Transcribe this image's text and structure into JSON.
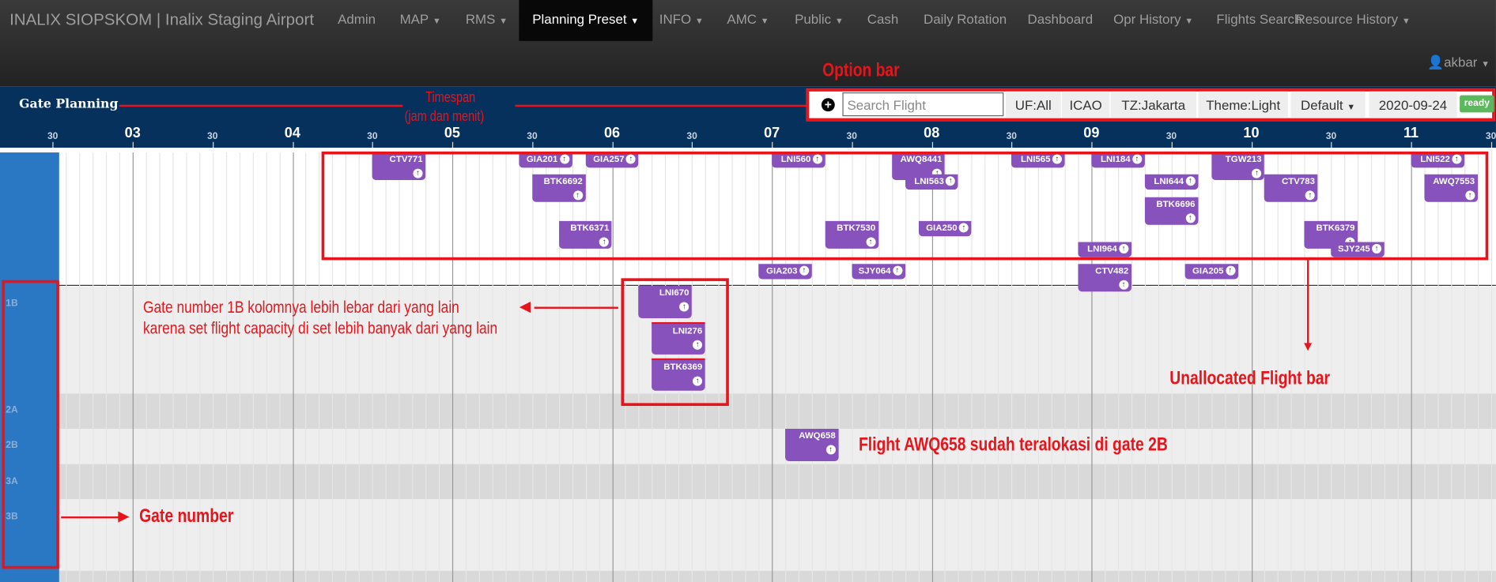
{
  "navbar": {
    "brand": "INALIX SIOPSKOM | Inalix Staging Airport",
    "items": [
      {
        "label": "Admin",
        "dropdown": false
      },
      {
        "label": "MAP",
        "dropdown": true
      },
      {
        "label": "RMS",
        "dropdown": true
      },
      {
        "label": "Planning Preset",
        "dropdown": true,
        "active": true
      },
      {
        "label": "INFO",
        "dropdown": true
      },
      {
        "label": "AMC",
        "dropdown": true
      },
      {
        "label": "Public",
        "dropdown": true
      },
      {
        "label": "Cash",
        "dropdown": false
      },
      {
        "label": "Daily Rotation",
        "dropdown": false
      },
      {
        "label": "Dashboard",
        "dropdown": false
      },
      {
        "label": "Opr History",
        "dropdown": true
      },
      {
        "label": "Flights Search",
        "dropdown": false
      },
      {
        "label": "Resource History",
        "dropdown": true
      }
    ],
    "user": "akbar"
  },
  "header": {
    "title": "Gate Planning"
  },
  "options": {
    "search_placeholder": "Search Flight",
    "uf": "UF:All",
    "icao": "ICAO",
    "tz": "TZ:Jakarta",
    "theme": "Theme:Light",
    "preset": "Default",
    "date": "2020-09-24",
    "status": "ready"
  },
  "timeline": {
    "labels": [
      {
        "t": 2.5,
        "text": "30"
      },
      {
        "t": 3,
        "text": "03"
      },
      {
        "t": 3.5,
        "text": "30"
      },
      {
        "t": 4,
        "text": "04"
      },
      {
        "t": 4.5,
        "text": "30"
      },
      {
        "t": 5,
        "text": "05"
      },
      {
        "t": 5.5,
        "text": "30"
      },
      {
        "t": 6,
        "text": "06"
      },
      {
        "t": 6.5,
        "text": "30"
      },
      {
        "t": 7,
        "text": "07"
      },
      {
        "t": 7.5,
        "text": "30"
      },
      {
        "t": 8,
        "text": "08"
      },
      {
        "t": 8.5,
        "text": "30"
      },
      {
        "t": 9,
        "text": "09"
      },
      {
        "t": 9.5,
        "text": "30"
      },
      {
        "t": 10,
        "text": "10"
      },
      {
        "t": 10.5,
        "text": "30"
      },
      {
        "t": 11,
        "text": "11"
      },
      {
        "t": 11.5,
        "text": "30"
      }
    ]
  },
  "gates": [
    "1B",
    "2A",
    "2B",
    "3A",
    "3B"
  ],
  "flights": [
    {
      "code": "CTV771",
      "start": "04:30",
      "end": "04:50",
      "tall": true
    },
    {
      "code": "GIA201",
      "start": "05:25",
      "end": "05:45"
    },
    {
      "code": "GIA257",
      "start": "05:50",
      "end": "06:10"
    },
    {
      "code": "BTK6692",
      "start": "05:30",
      "end": "05:50",
      "tall": true
    },
    {
      "code": "BTK6371",
      "start": "05:40",
      "end": "06:00",
      "tall": true
    },
    {
      "code": "LNI560",
      "start": "07:00",
      "end": "07:20"
    },
    {
      "code": "AWQ8441",
      "start": "07:45",
      "end": "08:05",
      "tall": true
    },
    {
      "code": "LNI563",
      "start": "07:50",
      "end": "08:10"
    },
    {
      "code": "LNI565",
      "start": "08:30",
      "end": "08:50"
    },
    {
      "code": "LNI184",
      "start": "09:00",
      "end": "09:20"
    },
    {
      "code": "TGW213",
      "start": "09:45",
      "end": "10:05",
      "tall": true
    },
    {
      "code": "LNI522",
      "start": "11:00",
      "end": "11:20"
    },
    {
      "code": "LNI644",
      "start": "09:20",
      "end": "09:40"
    },
    {
      "code": "CTV783",
      "start": "10:05",
      "end": "10:25",
      "tall": true
    },
    {
      "code": "AWQ7553",
      "start": "11:05",
      "end": "11:25",
      "tall": true
    },
    {
      "code": "BTK6696",
      "start": "09:20",
      "end": "09:40",
      "tall": true
    },
    {
      "code": "BTK7530",
      "start": "07:20",
      "end": "07:40",
      "tall": true
    },
    {
      "code": "GIA250",
      "start": "07:55",
      "end": "08:15"
    },
    {
      "code": "BTK6379",
      "start": "10:20",
      "end": "10:40",
      "tall": true
    },
    {
      "code": "SJY245",
      "start": "10:30",
      "end": "10:50"
    },
    {
      "code": "LNI964",
      "start": "08:55",
      "end": "09:15"
    },
    {
      "code": "GIA203",
      "start": "06:55",
      "end": "07:15"
    },
    {
      "code": "SJY064",
      "start": "07:30",
      "end": "07:50"
    },
    {
      "code": "CTV482",
      "start": "08:55",
      "end": "09:15",
      "tall": true
    },
    {
      "code": "GIA205",
      "start": "09:35",
      "end": "09:55"
    },
    {
      "code": "LNI670",
      "start": "06:10",
      "end": "06:30",
      "tall": true,
      "gate": "1B"
    },
    {
      "code": "LNI276",
      "start": "06:15",
      "end": "06:35",
      "tall": true,
      "gate": "1B"
    },
    {
      "code": "BTK6369",
      "start": "06:15",
      "end": "06:35",
      "tall": true,
      "gate": "1B"
    },
    {
      "code": "AWQ658",
      "start": "07:05",
      "end": "07:25",
      "tall": true,
      "gate": "2B"
    }
  ],
  "annotations": {
    "option_bar": "Option bar",
    "timespan_1": "Timespan",
    "timespan_2": "(jam dan menit)",
    "gate1b_1": "Gate number 1B kolomnya lebih lebar dari yang lain",
    "gate1b_2": "karena set flight capacity di set lebih banyak dari yang lain",
    "unallocated": "Unallocated Flight bar",
    "awq658": "Flight AWQ658 sudah teralokasi di gate 2B",
    "gate_number": "Gate number"
  },
  "colors": {
    "flight": "#8752bc",
    "band": "#06315d",
    "gatecol": "#2a77c4",
    "annotation": "#e8141b"
  }
}
